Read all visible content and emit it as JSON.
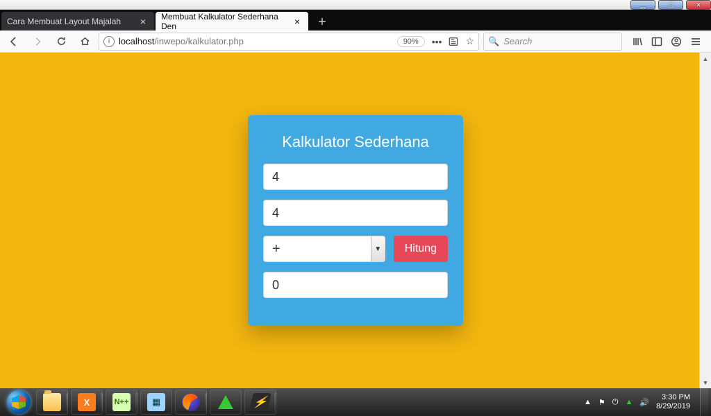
{
  "window_controls": {
    "min": "▁",
    "max": "▢",
    "close": "✕"
  },
  "tabs": [
    {
      "title": "Cara Membuat Layout Majalah",
      "active": false
    },
    {
      "title": "Membuat Kalkulator Sederhana Den",
      "active": true
    }
  ],
  "toolbar": {
    "url_host": "localhost",
    "url_path": "/inwepo/kalkulator.php",
    "zoom": "90%",
    "search_placeholder": "Search"
  },
  "calculator": {
    "heading": "Kalkulator Sederhana",
    "input1": "4",
    "input2": "4",
    "operator_selected": "+",
    "button_label": "Hitung",
    "result": "0"
  },
  "taskbar": {
    "xampp_label": "X",
    "npp_label": "N++",
    "calc_label": "▦",
    "amp_label": "⚡"
  },
  "tray": {
    "up": "▲",
    "flag": "⚑",
    "power": "⏻",
    "net_up": "▲",
    "speaker": "🔊",
    "time": "3:30 PM",
    "date": "8/29/2019"
  }
}
